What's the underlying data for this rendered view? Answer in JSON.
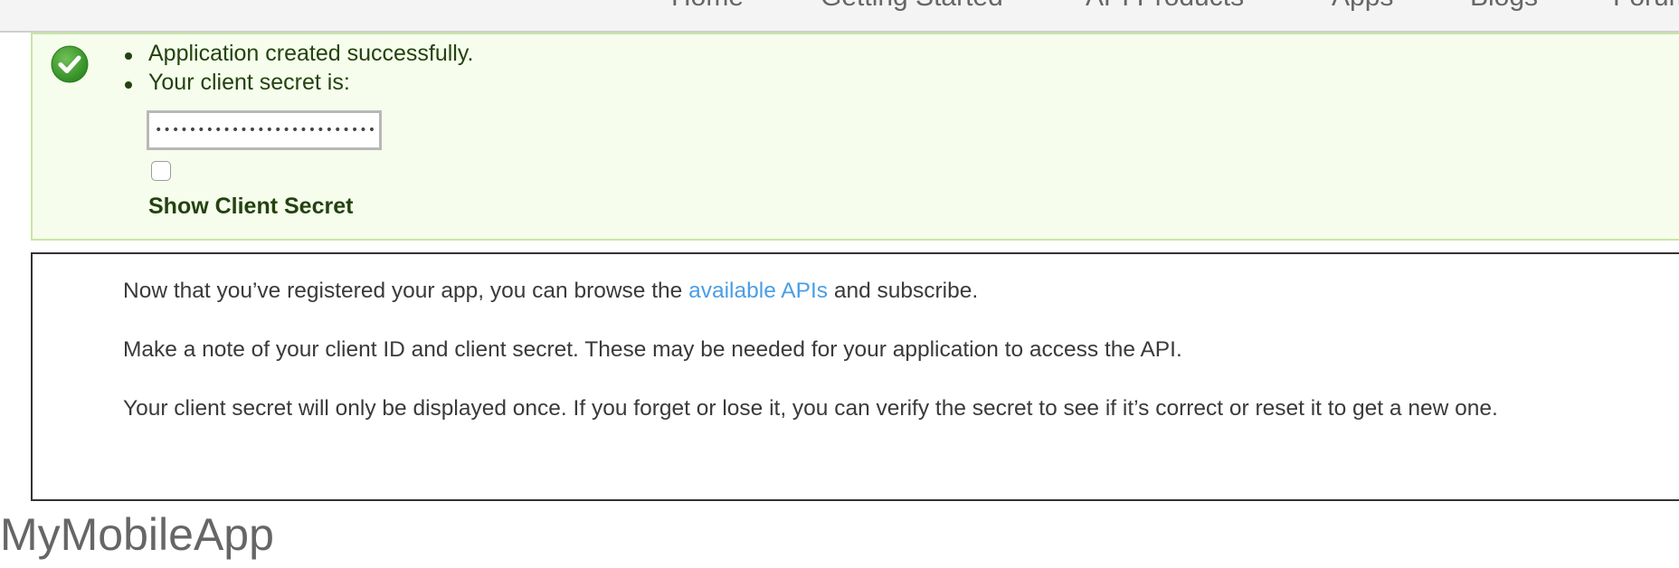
{
  "nav": {
    "items": [
      "Home",
      "Getting Started",
      "API Products",
      "Apps",
      "Blogs",
      "Forums"
    ]
  },
  "success": {
    "icon": "checkmark-circle-icon",
    "messages": [
      "Application created successfully.",
      "Your client secret is:"
    ],
    "secret_value": "••••••••••••••••••••••••••••••••",
    "show_secret_label": "Show Client Secret",
    "show_secret_checked": false
  },
  "info": {
    "line1_prefix": "Now that you’ve registered your app, you can browse the ",
    "line1_link": "available APIs",
    "line1_suffix": " and subscribe.",
    "line2": "Make a note of your client ID and client secret. These may be needed for your application to access the API.",
    "line3": "Your client secret will only be displayed once. If you forget or lose it, you can verify the secret to see if it’s correct or reset it to get a new one."
  },
  "app": {
    "title": "MyMobileApp"
  },
  "colors": {
    "success_bg": "#f6fdec",
    "success_border": "#c6e6a6",
    "success_text": "#23420f",
    "check_green": "#3d9a2c",
    "link": "#4a9ee6",
    "body_text": "#3a3a3a",
    "title_gray": "#666666"
  }
}
